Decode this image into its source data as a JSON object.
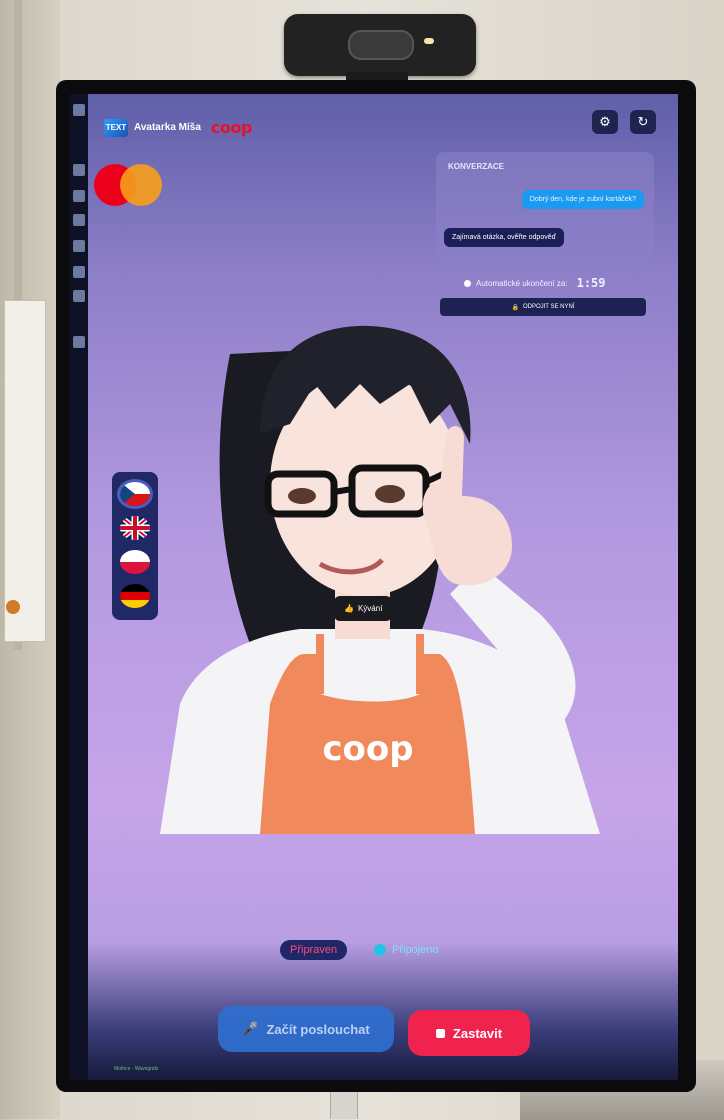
{
  "header": {
    "brand_logo": "TEXT",
    "brand_title": "Avatarka Míša",
    "coop_logo": "coop",
    "settings_icon": "gear-icon",
    "refresh_icon": "refresh-icon"
  },
  "conversation": {
    "title": "KONVERZACE",
    "user_message": "Dobrý den, kde je zubní kartáček?",
    "bot_message": "Zajímavá otázka, ověřte odpověď"
  },
  "session": {
    "auto_end_label": "Automatické ukončení za:",
    "countdown": "1:59",
    "disconnect_label": "ODPOJIT SE NYNÍ",
    "disconnect_icon": "lock-icon"
  },
  "languages": [
    {
      "name": "cz",
      "selected": true
    },
    {
      "name": "uk",
      "selected": false
    },
    {
      "name": "pl",
      "selected": false
    },
    {
      "name": "de",
      "selected": false
    }
  ],
  "avatar": {
    "apron_logo": "coop",
    "gesture_label": "Kývání",
    "gesture_icon": "thumbs-up-icon"
  },
  "status": {
    "ready": "Připraven",
    "connection": "Připojeno"
  },
  "actions": {
    "listen_label": "Začít poslouchat",
    "stop_label": "Zastavit"
  },
  "footer": {
    "version": "Mofrice · Wavegrids"
  },
  "colors": {
    "stop": "#f0234f",
    "listen": "#2f6fd0",
    "coop_red": "#e3132a"
  }
}
